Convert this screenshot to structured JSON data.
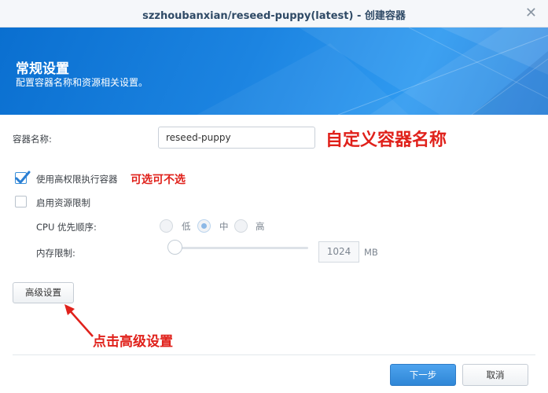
{
  "window": {
    "title": "szzhoubanxian/reseed-puppy(latest) - 创建容器",
    "close_glyph": "✕"
  },
  "header": {
    "title": "常规设置",
    "subtitle": "配置容器名称和资源相关设置。"
  },
  "form": {
    "container_name_label": "容器名称:",
    "container_name_value": "reseed-puppy",
    "privileged_label": "使用高权限执行容器",
    "privileged_checked": true,
    "resource_limit_label": "启用资源限制",
    "resource_limit_checked": false,
    "cpu_priority_label": "CPU 优先顺序:",
    "cpu_priority_options": [
      "低",
      "中",
      "高"
    ],
    "cpu_priority_selected": "中",
    "memory_label": "内存限制:",
    "memory_value": "1024",
    "memory_unit": "MB",
    "memory_slider_fraction": 0
  },
  "annotations": {
    "name_hint": "自定义容器名称",
    "privileged_hint": "可选可不选",
    "advanced_hint": "点击高级设置",
    "color": "#e0211b"
  },
  "buttons": {
    "advanced": "高级设置",
    "next": "下一步",
    "cancel": "取消"
  },
  "colors": {
    "accent": "#2f86d6",
    "banner": "#1c84e1"
  }
}
